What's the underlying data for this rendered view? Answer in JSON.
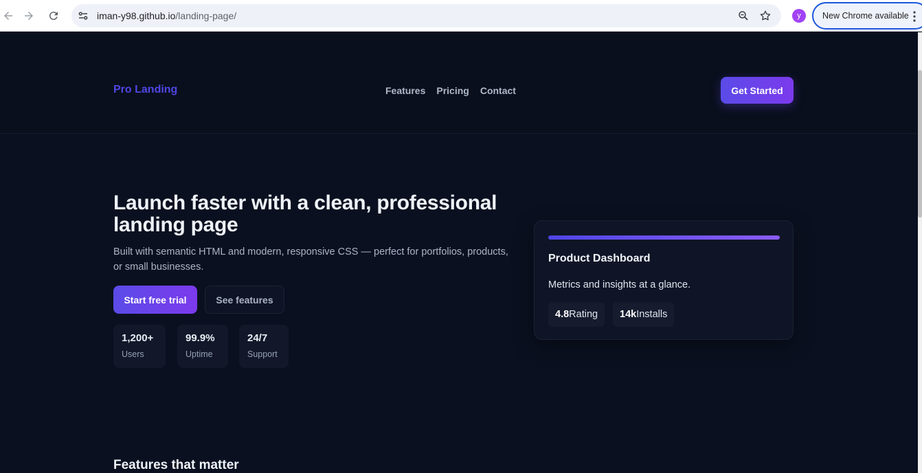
{
  "browser": {
    "url_host": "iman-y98.github.io",
    "url_path": "/landing-page/",
    "profile_initial": "y",
    "update_label": "New Chrome available",
    "icons": [
      "back-icon",
      "forward-icon",
      "reload-icon",
      "site-info-icon",
      "zoom-icon",
      "star-icon",
      "kebab-icon"
    ]
  },
  "header": {
    "logo": "Pro Landing",
    "nav": [
      "Features",
      "Pricing",
      "Contact"
    ],
    "cta": "Get Started"
  },
  "hero": {
    "title": "Launch faster with a clean, professional landing page",
    "subtitle": "Built with semantic HTML and modern, responsive CSS — perfect for portfolios, products, or small businesses.",
    "primary_button": "Start free trial",
    "secondary_button": "See features",
    "stats": [
      {
        "value": "1,200+",
        "label": "Users"
      },
      {
        "value": "99.9%",
        "label": "Uptime"
      },
      {
        "value": "24/7",
        "label": "Support"
      }
    ]
  },
  "card": {
    "title": "Product Dashboard",
    "subtitle": "Metrics and insights at a glance.",
    "pills": [
      {
        "value": "4.8",
        "label": "Rating"
      },
      {
        "value": "14k",
        "label": "Installs"
      }
    ]
  },
  "features": {
    "title": "Features that matter"
  },
  "colors": {
    "accent": "#4f46e5",
    "accent_gradient_end": "#7c3aed",
    "background": "#0b1020"
  }
}
